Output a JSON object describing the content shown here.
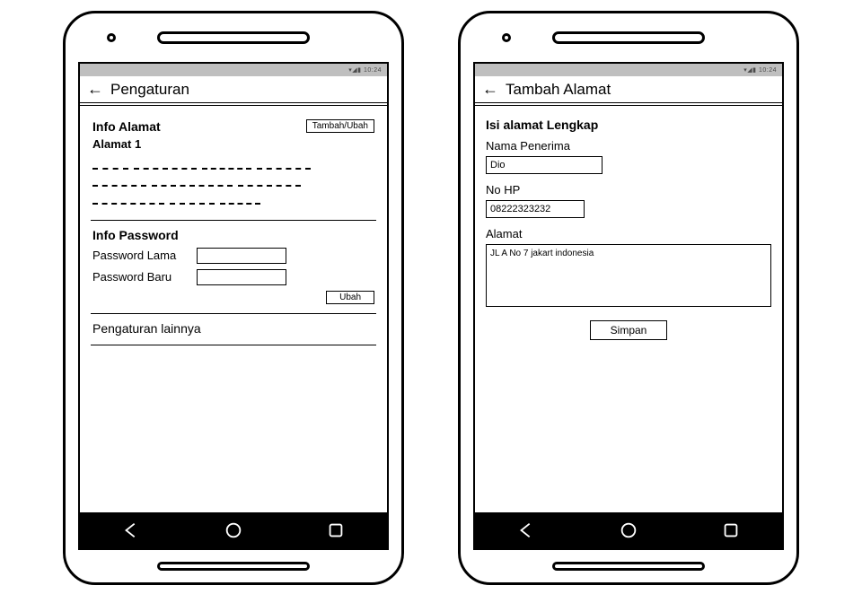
{
  "status": {
    "text": "▾◢▮ 10:24"
  },
  "left": {
    "title": "Pengaturan",
    "info_alamat": {
      "title": "Info Alamat",
      "btn": "Tambah/Ubah",
      "alamat_label": "Alamat 1"
    },
    "info_password": {
      "title": "Info Password",
      "old_label": "Password Lama",
      "new_label": "Password Baru",
      "btn": "Ubah"
    },
    "other": {
      "title": "Pengaturan lainnya"
    }
  },
  "right": {
    "title": "Tambah Alamat",
    "form_title": "Isi alamat Lengkap",
    "nama": {
      "label": "Nama Penerima",
      "value": "Dio"
    },
    "hp": {
      "label": "No HP",
      "value": "08222323232"
    },
    "alamat": {
      "label": "Alamat",
      "value": "JL A No 7 jakart indonesia"
    },
    "save_btn": "Simpan"
  }
}
